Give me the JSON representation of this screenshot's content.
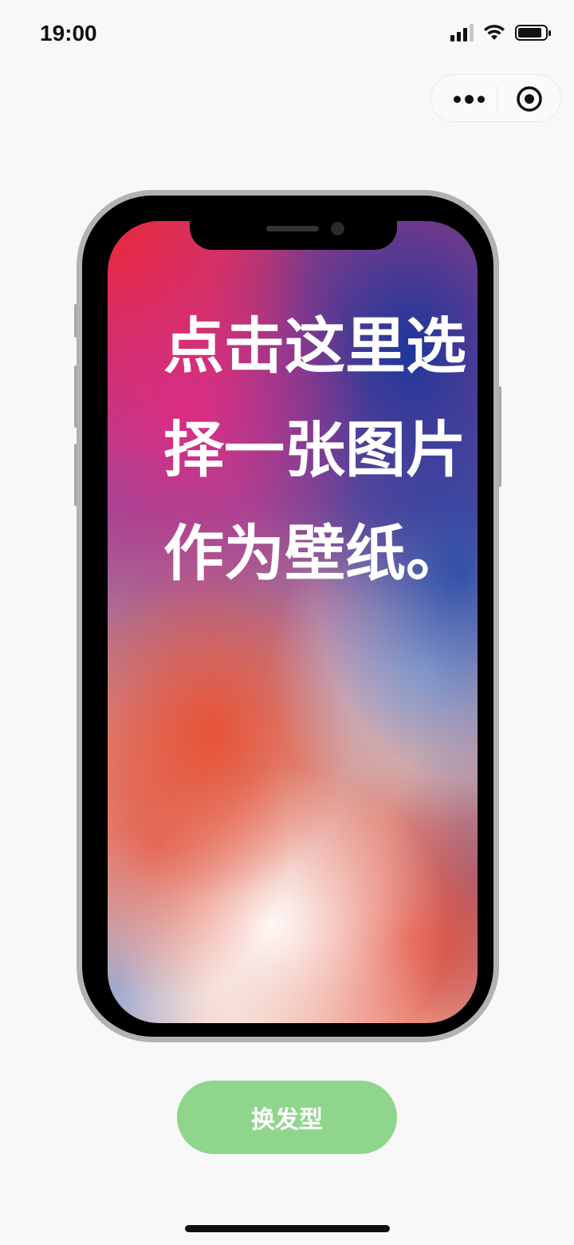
{
  "status_bar": {
    "time": "19:00",
    "icons": [
      "signal-icon",
      "wifi-icon",
      "battery-icon"
    ]
  },
  "capsule_menu": {
    "icons": [
      "more-icon",
      "close-target-icon"
    ]
  },
  "phone_preview": {
    "prompt_text": "点击这里选择一张图片作为壁纸。"
  },
  "action_button": {
    "label": "换发型"
  },
  "colors": {
    "button_background": "#8fd68c",
    "page_background": "#f8f8f8"
  }
}
